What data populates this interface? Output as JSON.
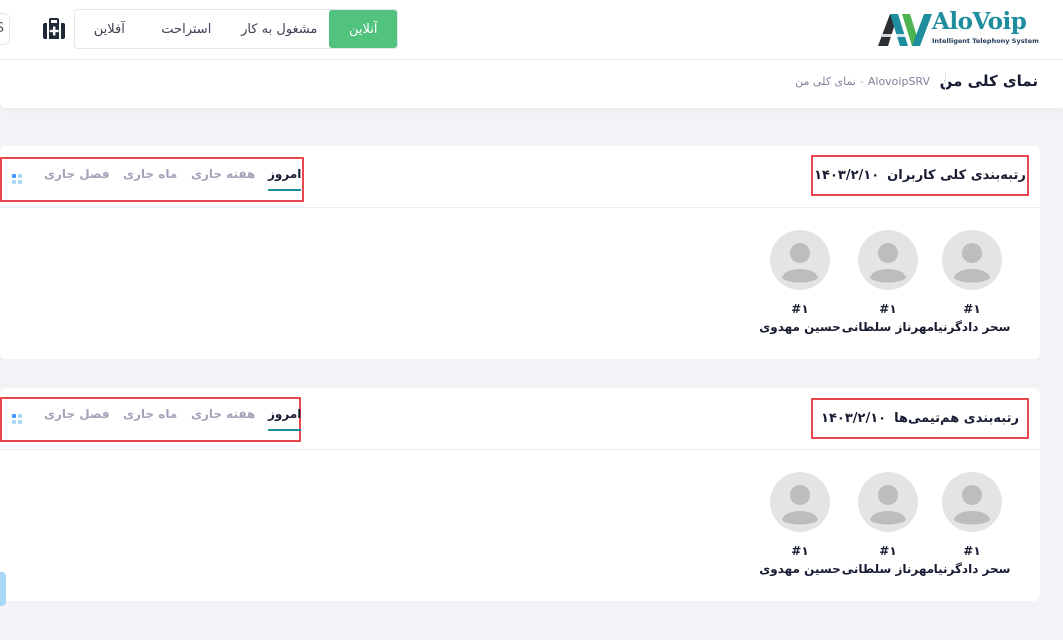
{
  "header": {
    "edge_button_label": "S",
    "status_buttons": {
      "offline": "آفلاین",
      "rest": "استراحت",
      "busy": "مشغول به کار",
      "online": "آنلاین"
    },
    "logo": {
      "text": "AloVoip",
      "tagline": "Intelligent Telephony System"
    }
  },
  "subheader": {
    "page_title": "نمای کلی من",
    "breadcrumb": [
      "AlovoipSRV",
      "نمای کلی من"
    ],
    "breadcrumb_separator": "-"
  },
  "tabs": {
    "today": "امروز",
    "week": "هفته جاری",
    "month": "ماه جاری",
    "season": "فصل جاری"
  },
  "cards": [
    {
      "title": "رتبه‌بندی کلی کاربران",
      "date": "۱۴۰۳/۲/۱۰",
      "active_tab": "today",
      "users": [
        {
          "rank": "#۱",
          "name": "سحر دادگرنیا"
        },
        {
          "rank": "#۱",
          "name": "مهرناز سلطانی"
        },
        {
          "rank": "#۱",
          "name": "حسین مهدوی"
        }
      ]
    },
    {
      "title": "رتبه‌بندی هم‌تیمی‌ها",
      "date": "۱۴۰۳/۲/۱۰",
      "active_tab": "today",
      "users": [
        {
          "rank": "#۱",
          "name": "سحر دادگرنیا"
        },
        {
          "rank": "#۱",
          "name": "مهرناز سلطانی"
        },
        {
          "rank": "#۱",
          "name": "حسین مهدوی"
        }
      ]
    }
  ],
  "colors": {
    "online_green": "#52c27f",
    "highlight_red": "#e8484d",
    "brand_teal": "#1e8e9e",
    "avatar_gray": "#bdbdbd"
  }
}
